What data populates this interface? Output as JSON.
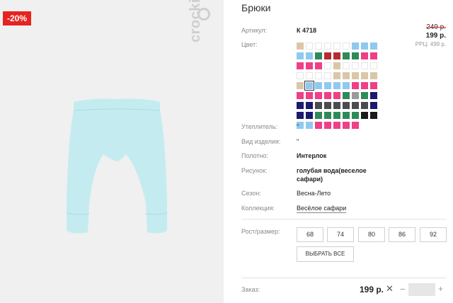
{
  "product": {
    "discount_badge": "-20%",
    "brand": "crockid",
    "title": "Брюки",
    "price_old": "249 р.",
    "price_new": "199 р.",
    "rrp": "РРЦ: 499 р."
  },
  "details": {
    "article_label": "Артикул:",
    "article_value": "К 4718",
    "color_label": "Цвет:",
    "insulation_label": "Утеплитель:",
    "insulation_value": "\"",
    "type_label": "Вид изделия:",
    "type_value": "\"",
    "fabric_label": "Полотно:",
    "fabric_value": "Интерлок",
    "pattern_label": "Рисунок:",
    "pattern_value_1": "голубая вода(веселое",
    "pattern_value_2": "сафари)",
    "season_label": "Сезон:",
    "season_value": "Весна-Лето",
    "collection_label": "Коллекция:",
    "collection_value": "Весёлое сафари",
    "size_label": "Рост/размер:",
    "sizes": [
      "68",
      "74",
      "80",
      "86",
      "92"
    ],
    "select_all": "ВЫБРАТЬ ВСЕ"
  },
  "order": {
    "label": "Заказ:",
    "price": "199 р.",
    "remove_icon": "close-icon",
    "minus": "−",
    "plus": "+",
    "quantity": ""
  },
  "colors": {
    "accent": "#e52421",
    "garment": "#c4ecf0",
    "swatch_palette": {
      "b": "#d9c7a7",
      "l": "#8fc9f0",
      "g": "#2f8a5a",
      "r": "#b52c32",
      "p": "#ef3f86",
      "n": "#1a1a6e",
      "d": "#4a4a4f",
      "k": "#1a1a1a",
      "s": "#9a9a9a",
      "e": "empty"
    },
    "swatch_rows": [
      [
        "b",
        "e",
        "e",
        "e",
        "e",
        "e",
        "l",
        "l",
        "l"
      ],
      [
        "l",
        "l",
        "g",
        "r",
        "r",
        "g",
        "g",
        "p",
        "p"
      ],
      [
        "p",
        "p",
        "p",
        "e",
        "b",
        "e",
        "e",
        "e",
        "e"
      ],
      [
        "e",
        "e",
        "e",
        "e",
        "b",
        "b",
        "b",
        "b",
        "b"
      ],
      [
        "b",
        "l",
        "l",
        "l",
        "l",
        "l",
        "p",
        "p",
        "p"
      ],
      [
        "p",
        "p",
        "p",
        "p",
        "p",
        "g",
        "s",
        "g",
        "n"
      ],
      [
        "n",
        "n",
        "d",
        "d",
        "d",
        "d",
        "d",
        "d",
        "n"
      ],
      [
        "n",
        "n",
        "g",
        "g",
        "g",
        "g",
        "g",
        "k",
        "k"
      ],
      [
        "l",
        "l",
        "p",
        "p",
        "p",
        "p",
        "p"
      ]
    ],
    "selected_swatch": "4-1"
  }
}
